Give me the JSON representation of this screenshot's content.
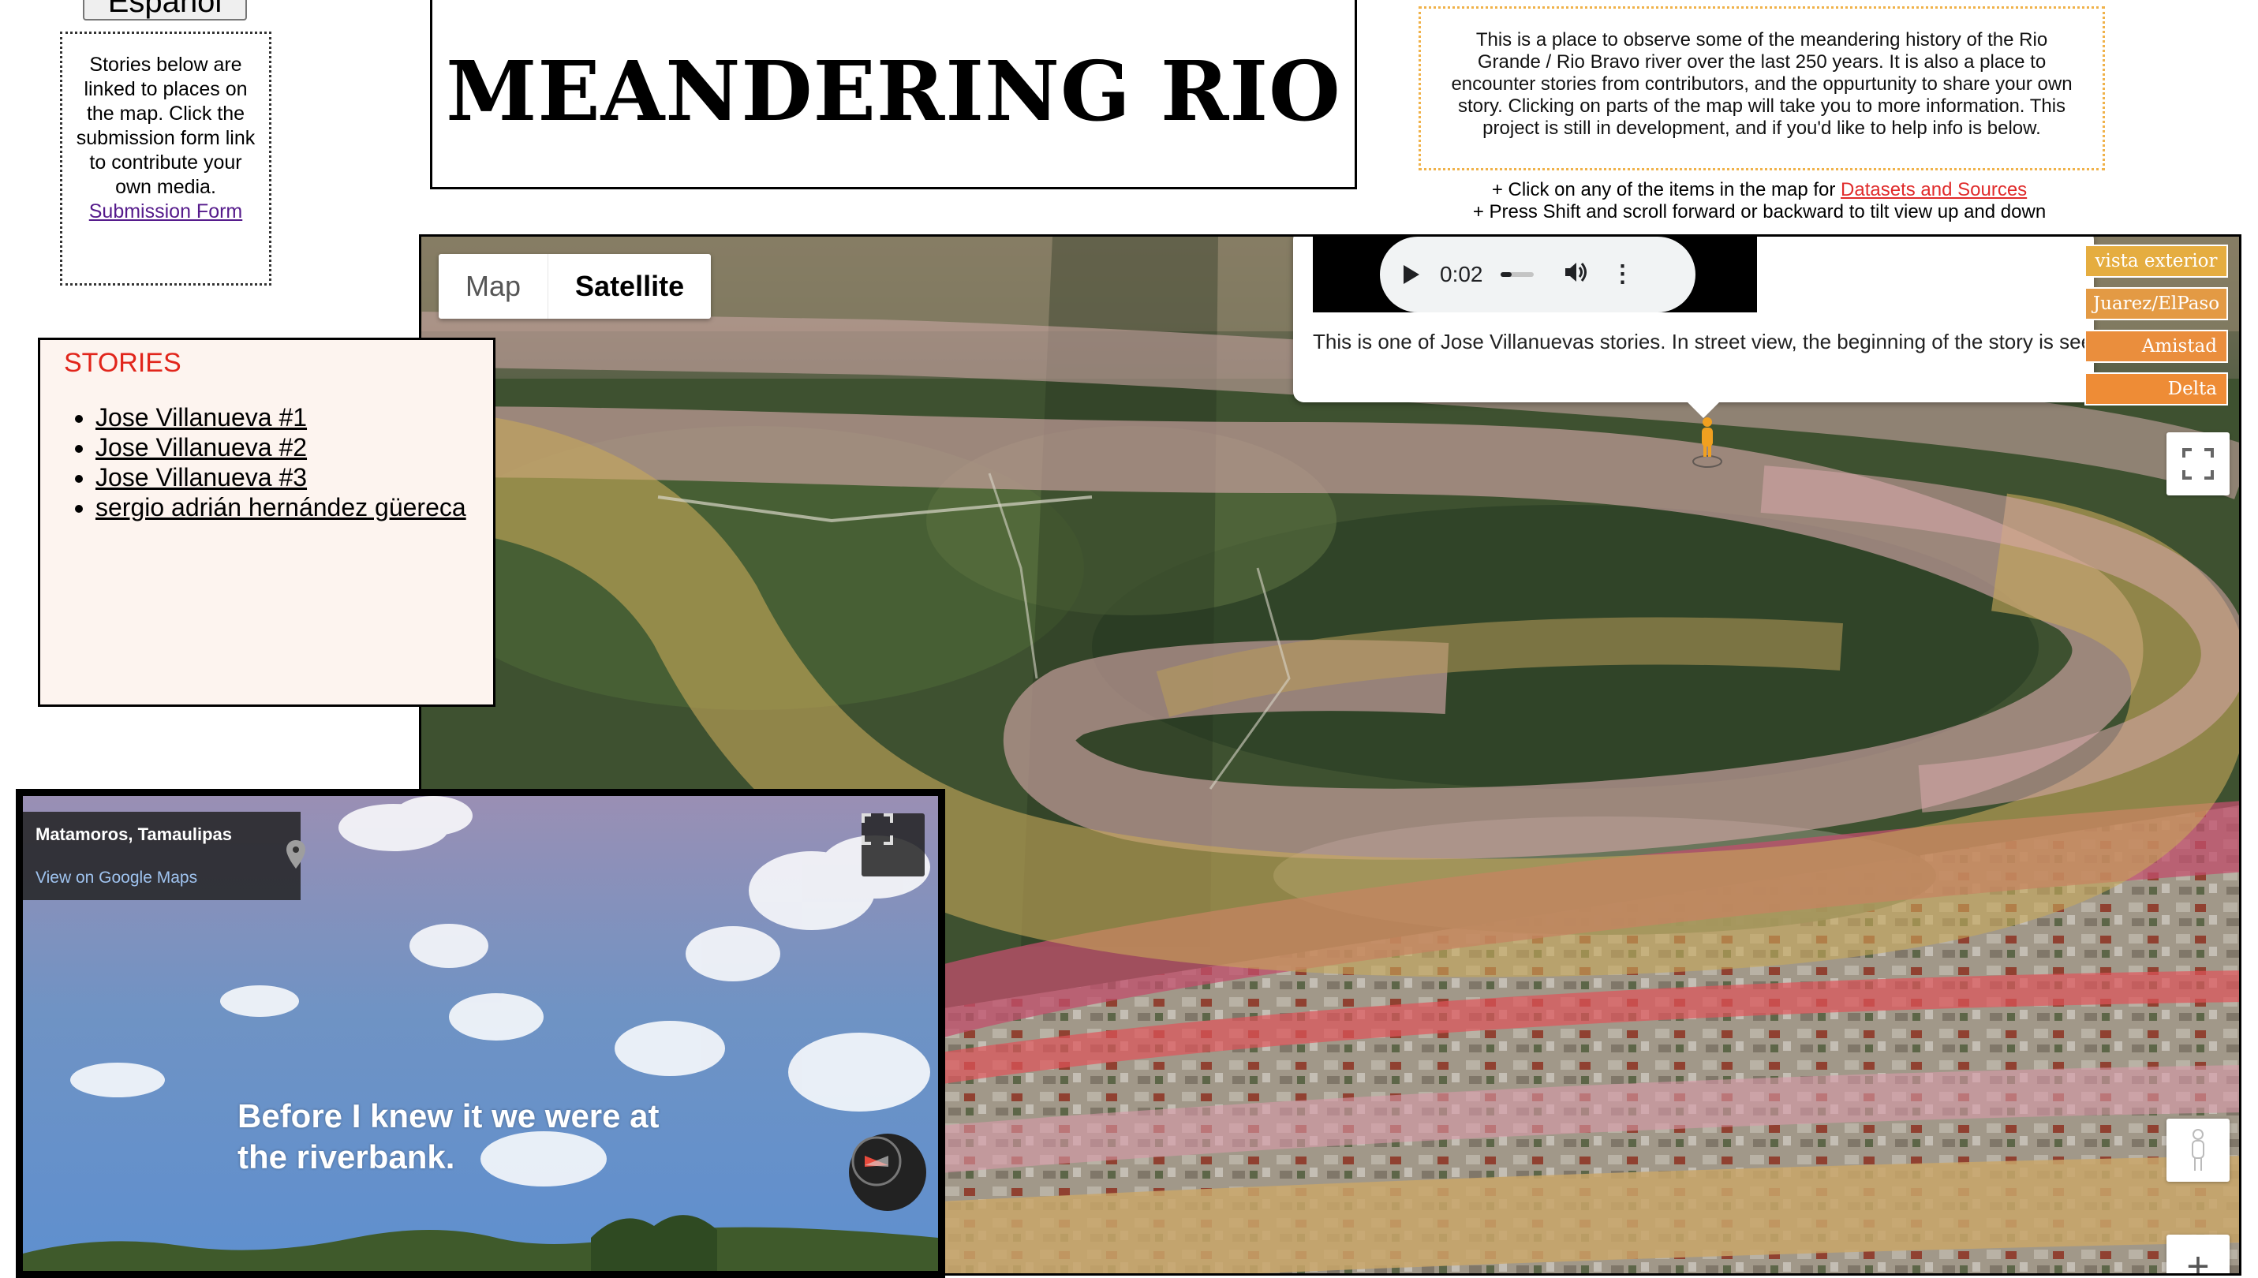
{
  "lang_button": "Español",
  "intro": {
    "text": "Stories below are linked to places on the map. Click the submission form link to contribute your own media.",
    "link": "Submission Form"
  },
  "title": "MEANDERING RIO",
  "about": "This is a place to observe some of the meandering history of the Rio Grande / Rio Bravo river over the last 250 years. It is also a place to encounter stories from contributors, and the oppurtunity to share your own story. Clicking on parts of the map will take you to more information. This project is still in development, and if you'd like to help info is below.",
  "hints": {
    "line1_prefix": "+ Click on any of the items in the map for ",
    "line1_link": "Datasets and Sources",
    "line2": "+ Press Shift and scroll forward or backward to tilt view up and down"
  },
  "map": {
    "type_map": "Map",
    "type_satellite": "Satellite",
    "popup": {
      "audio_time": "0:02",
      "text": "This is one of Jose Villanuevas stories. In street view, the beginning of the story is seen"
    },
    "layers": [
      "vista exterior",
      "Juarez/ElPaso",
      "Amistad",
      "Delta"
    ],
    "zoom_in": "+"
  },
  "stories": {
    "heading": "STORIES",
    "items": [
      "Jose Villanueva #1",
      "Jose Villanueva #2",
      "Jose Villanueva #3",
      "sergio adrián hernández güereca"
    ]
  },
  "street_view": {
    "location": "Matamoros, Tamaulipas",
    "link": "View on Google Maps",
    "caption": "Before I knew it we were at the riverbank."
  },
  "colors": {
    "accent_red": "#e1251b",
    "layer_orange": "#e39a44",
    "about_border": "#f0b24a"
  }
}
